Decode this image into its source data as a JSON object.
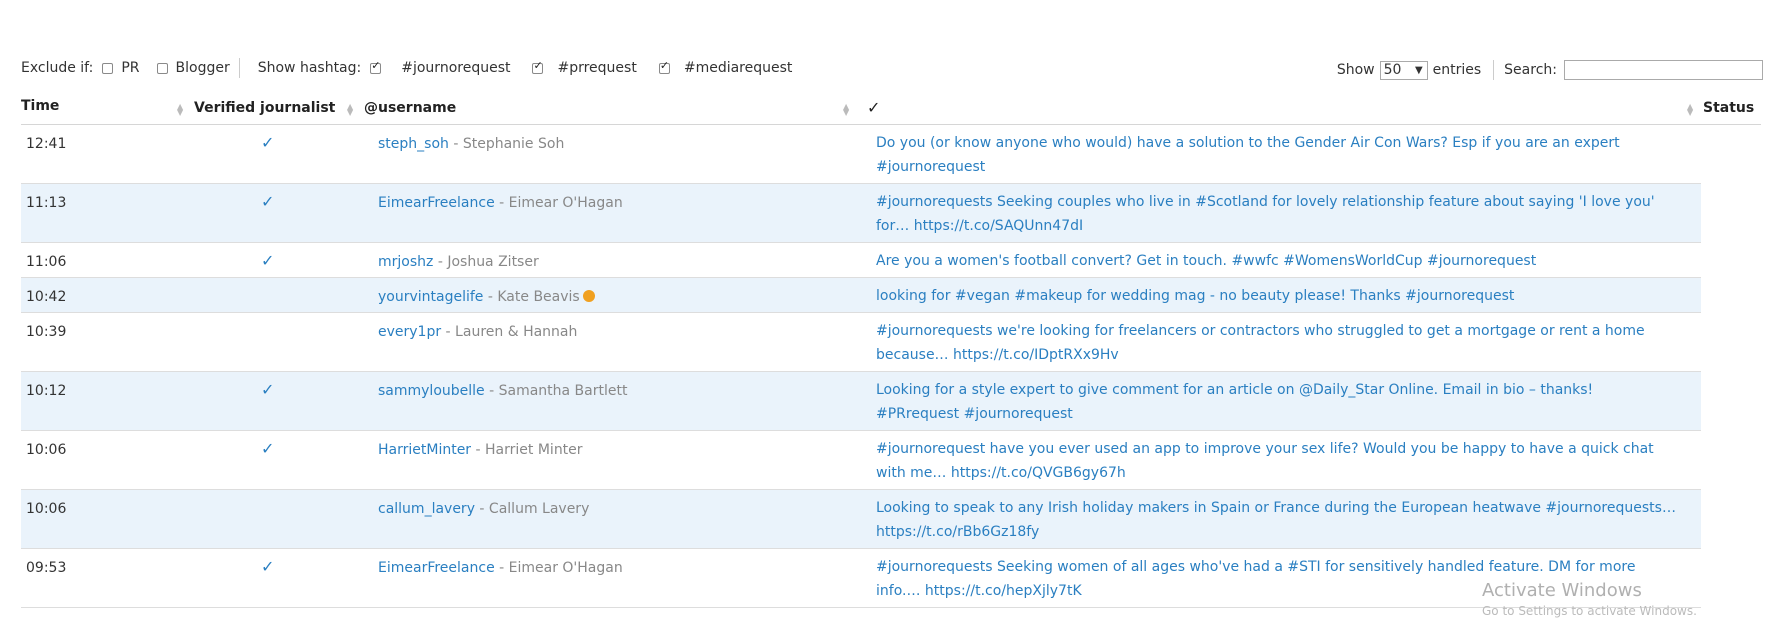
{
  "filters": {
    "exclude_label": "Exclude if:",
    "exclude_options": [
      {
        "label": "PR",
        "checked": false
      },
      {
        "label": "Blogger",
        "checked": false
      }
    ],
    "hashtag_label": "Show hashtag:",
    "hashtags": [
      {
        "label": "#journorequest",
        "checked": true
      },
      {
        "label": "#prrequest",
        "checked": true
      },
      {
        "label": "#mediarequest",
        "checked": true
      }
    ],
    "show_label": "Show",
    "entries_value": "50",
    "entries_label": "entries",
    "search_label": "Search:",
    "search_value": ""
  },
  "columns": {
    "time": "Time",
    "verified": "Verified journalist",
    "username": "@username",
    "check": "✓",
    "status": "Status"
  },
  "rows": [
    {
      "time": "12:41",
      "verified": "✓",
      "username": "steph_soh",
      "name": " - Stephanie Soh",
      "tweet": "Do you (or know anyone who would) have a solution to the Gender Air Con Wars? Esp if you are an expert #journorequest"
    },
    {
      "time": "11:13",
      "verified": "✓",
      "username": "EimearFreelance",
      "name": " - Eimear O'Hagan",
      "tweet": "#journorequests Seeking couples who live in #Scotland for lovely relationship feature about saying 'I love you' for… https://t.co/SAQUnn47dI"
    },
    {
      "time": "11:06",
      "verified": "✓",
      "username": "mrjoshz",
      "name": " - Joshua Zitser",
      "tweet": "Are you a women's football convert? Get in touch. #wwfc #WomensWorldCup #journorequest"
    },
    {
      "time": "10:42",
      "verified": "",
      "username": "yourvintagelife",
      "name": " - Kate Beavis",
      "emoji": true,
      "tweet": "looking for #vegan #makeup for wedding mag - no beauty please! Thanks #journorequest"
    },
    {
      "time": "10:39",
      "verified": "",
      "username": "every1pr",
      "name": " - Lauren & Hannah",
      "tweet": "#journorequests we're looking for freelancers or contractors who struggled to get a mortgage or rent a home because… https://t.co/IDptRXx9Hv"
    },
    {
      "time": "10:12",
      "verified": "✓",
      "username": "sammyloubelle",
      "name": " - Samantha Bartlett",
      "tweet": "Looking for a style expert to give comment for an article on @Daily_Star Online. Email in bio – thanks! #PRrequest #journorequest"
    },
    {
      "time": "10:06",
      "verified": "✓",
      "username": "HarrietMinter",
      "name": " - Harriet Minter",
      "tweet": "#journorequest have you ever used an app to improve your sex life? Would you be happy to have a quick chat with me… https://t.co/QVGB6gy67h"
    },
    {
      "time": "10:06",
      "verified": "",
      "username": "callum_lavery",
      "name": " - Callum Lavery",
      "tweet": "Looking to speak to any Irish holiday makers in Spain or France during the European heatwave #journorequests… https://t.co/rBb6Gz18fy"
    },
    {
      "time": "09:53",
      "verified": "✓",
      "username": "EimearFreelance",
      "name": " - Eimear O'Hagan",
      "tweet": "#journorequests Seeking women of all ages who've had a #STI for sensitively handled feature. DM for more info.… https://t.co/hepXjly7tK"
    }
  ],
  "watermark": {
    "title": "Activate Windows",
    "subtitle": "Go to Settings to activate Windows."
  },
  "colors": {
    "link": "#2a7fc1",
    "row_alt": "#eaf3fb",
    "muted": "#888888"
  }
}
